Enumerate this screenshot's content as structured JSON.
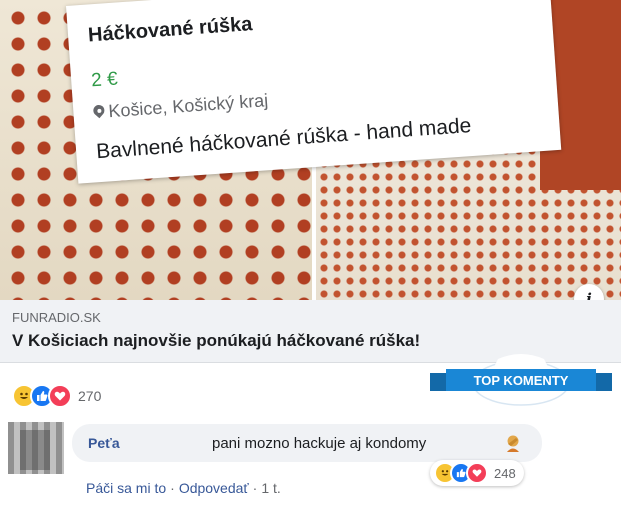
{
  "card": {
    "title": "Háčkované rúška",
    "price": "2 €",
    "location": "Košice, Košický kraj",
    "description": "Bavlnené háčkované rúška - hand made"
  },
  "link": {
    "domain": "FUNRADIO.SK",
    "headline": "V Košiciach najnovšie ponúkajú háčkované rúška!",
    "info_icon": "i"
  },
  "post_reactions": {
    "icons": [
      "haha-icon",
      "like-icon",
      "love-icon"
    ],
    "count": "270"
  },
  "badge": {
    "label": "TOP KOMENTY",
    "color": "#1a87d6"
  },
  "comment": {
    "author": "Peťa",
    "text": "pani mozno hackuje aj kondomy",
    "emoji": "facepalm-icon",
    "reaction_icons": [
      "haha-icon",
      "like-icon",
      "love-icon"
    ],
    "reaction_count": "248",
    "actions": {
      "like": "Páči sa mi to",
      "separator": "·",
      "reply": "Odpovedať",
      "time": "1 t."
    }
  },
  "colors": {
    "link_blue": "#385898",
    "price_green": "#2f9a47",
    "muted": "#65676b"
  }
}
